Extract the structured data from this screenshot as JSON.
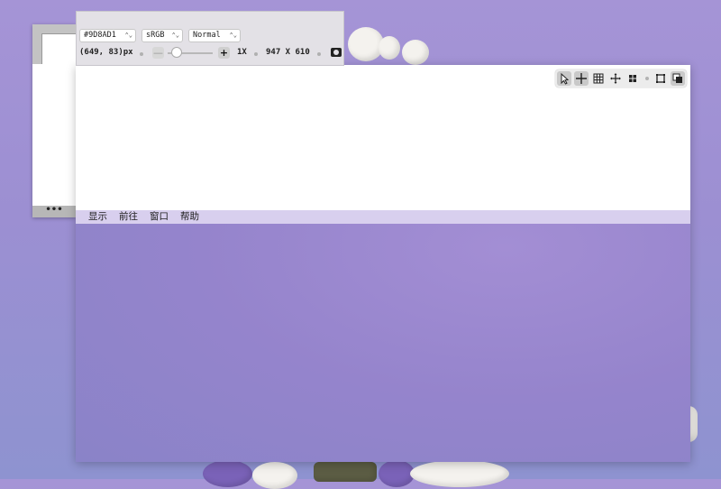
{
  "color_picker": {
    "hex_value": "#9D8AD1",
    "color_space": "sRGB",
    "blend_mode": "Normal",
    "coordinates": "(649, 83)px",
    "zoom_level": "1X",
    "dimensions": "947 X 610",
    "zoom_out_label": "—",
    "zoom_in_label": "+"
  },
  "loupe": {
    "handle_label": "•••"
  },
  "menubar": {
    "items": [
      "显示",
      "前往",
      "窗口",
      "帮助"
    ]
  },
  "toolbar": {
    "tools": [
      {
        "icon": "pointer-icon",
        "active": true
      },
      {
        "icon": "crosshair-icon",
        "active": true
      },
      {
        "icon": "grid-icon",
        "active": false
      },
      {
        "icon": "move-icon",
        "active": false
      },
      {
        "icon": "tiles-icon",
        "active": false
      },
      {
        "icon": "crop-frame-icon",
        "active": false
      },
      {
        "icon": "layers-icon",
        "active": true
      }
    ]
  },
  "colors": {
    "accent_sample": "#9D8AD1",
    "menubar_bg": "#d8cfee"
  }
}
